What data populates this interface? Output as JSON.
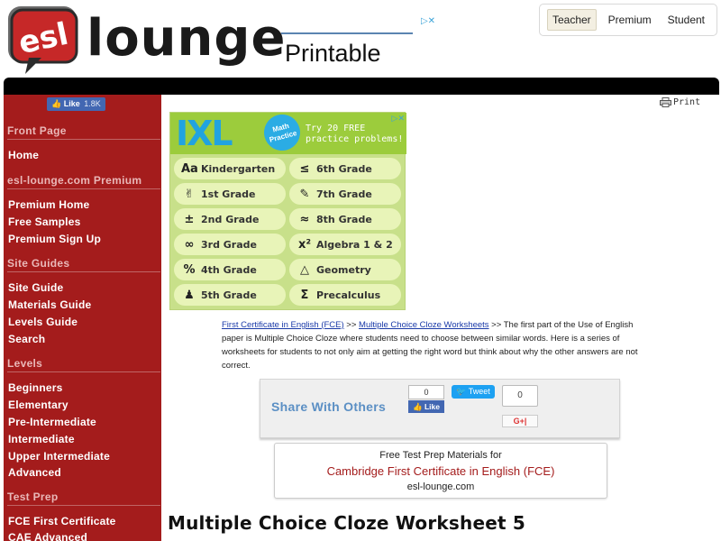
{
  "header": {
    "logo_badge": "esl",
    "logo_text": "lounge",
    "ad_text": "Printable",
    "nav": [
      {
        "label": "Teacher"
      },
      {
        "label": "Premium"
      },
      {
        "label": "Student"
      }
    ]
  },
  "sidebar": {
    "fb_like": "Like",
    "fb_count": "1.8K",
    "sections": [
      {
        "heading": "Front Page",
        "items": [
          "Home"
        ]
      },
      {
        "heading": "esl-lounge.com Premium",
        "items": [
          "Premium Home",
          "Free Samples",
          "Premium Sign Up"
        ]
      },
      {
        "heading": "Site Guides",
        "items": [
          "Site Guide",
          "Materials Guide",
          "Levels Guide",
          "Search"
        ]
      },
      {
        "heading": "Levels",
        "items": [
          "Beginners",
          "Elementary",
          "Pre-Intermediate",
          "Intermediate",
          "Upper Intermediate",
          "Advanced"
        ]
      },
      {
        "heading": "Test Prep",
        "items": [
          "FCE First Certificate",
          "CAE Advanced"
        ]
      }
    ]
  },
  "print_label": "Print",
  "ixl_ad": {
    "logo": "IXL",
    "badge": "Math Practice",
    "try_line1": "Try 20 FREE",
    "try_line2": "practice problems!",
    "grades_left": [
      {
        "icon": "Aa",
        "label": "Kindergarten"
      },
      {
        "icon": "✌",
        "label": "1st Grade"
      },
      {
        "icon": "±",
        "label": "2nd Grade"
      },
      {
        "icon": "∞",
        "label": "3rd Grade"
      },
      {
        "icon": "%",
        "label": "4th Grade"
      },
      {
        "icon": "♟",
        "label": "5th Grade"
      }
    ],
    "grades_right": [
      {
        "icon": "≤",
        "label": "6th Grade"
      },
      {
        "icon": "✎",
        "label": "7th Grade"
      },
      {
        "icon": "≈",
        "label": "8th Grade"
      },
      {
        "icon": "x²",
        "label": "Algebra 1 & 2"
      },
      {
        "icon": "△",
        "label": "Geometry"
      },
      {
        "icon": "Σ",
        "label": "Precalculus"
      }
    ]
  },
  "intro": {
    "link1": "First Certificate in English (FCE)",
    "sep1": " >> ",
    "link2": "Multiple Choice Cloze Worksheets",
    "sep2": " >> ",
    "text": "The first part of the Use of English paper is Multiple Choice Cloze where students need to choose between similar words. Here is a series of worksheets for students to not only aim at getting the right word but think about why the other answers are not correct."
  },
  "share": {
    "title": "Share With Others",
    "fb_count": "0",
    "fb_label": "Like",
    "tweet_label": "Tweet",
    "g_count": "0",
    "g_label": "G+|"
  },
  "prep_box": {
    "line1": "Free Test Prep Materials for",
    "line2": "Cambridge First Certificate in English (FCE)",
    "line3": "esl-lounge.com"
  },
  "page_title": "Multiple Choice Cloze Worksheet 5"
}
